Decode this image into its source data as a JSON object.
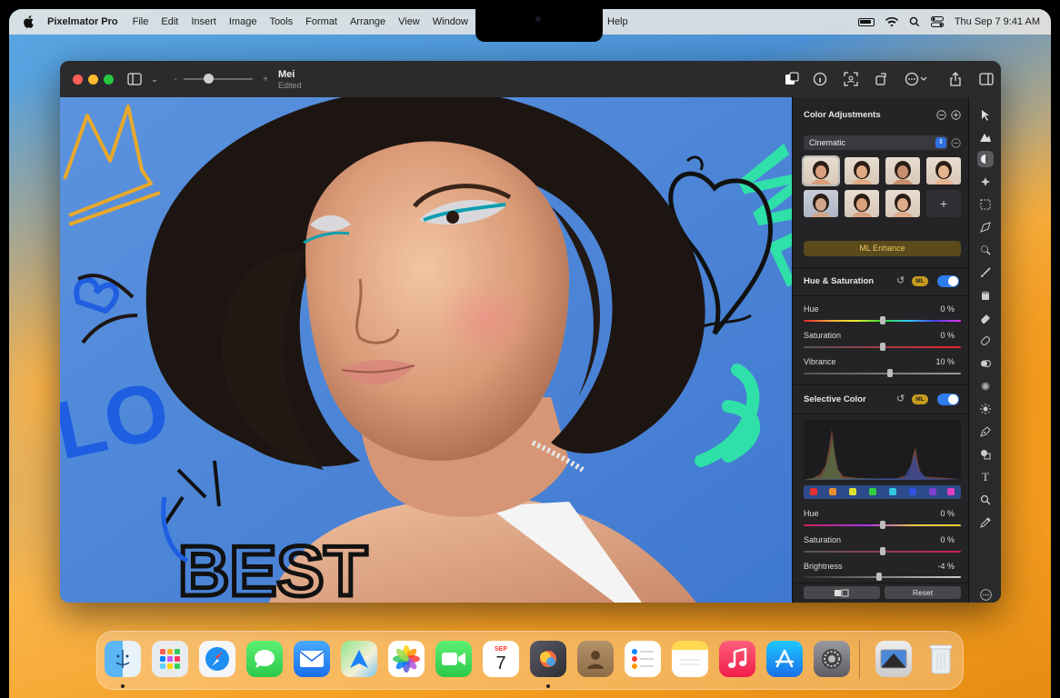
{
  "menubar": {
    "app_name": "Pixelmator Pro",
    "items": [
      "File",
      "Edit",
      "Insert",
      "Image",
      "Tools",
      "Format",
      "Arrange",
      "View",
      "Window"
    ],
    "help": "Help",
    "clock": "Thu Sep 7  9:41 AM"
  },
  "window": {
    "doc_title": "Mei",
    "doc_status": "Edited",
    "zoom_minus": "-",
    "zoom_plus": "+"
  },
  "canvas": {
    "graffiti_text": "BEST",
    "graffiti_text_2": "WE",
    "graffiti_text_3": "LO"
  },
  "sidebar": {
    "title": "Color Adjustments",
    "preset": "Cinematic",
    "ml_enhance": "ML Enhance",
    "add_thumb": "+",
    "hue_sat": {
      "title": "Hue & Saturation",
      "ml": "ML",
      "sliders": [
        {
          "label": "Hue",
          "value": "0 %",
          "level": 0.5
        },
        {
          "label": "Saturation",
          "value": "0 %",
          "level": 0.5
        },
        {
          "label": "Vibrance",
          "value": "10 %",
          "level": 0.55
        }
      ]
    },
    "selective": {
      "title": "Selective Color",
      "ml": "ML",
      "sliders": [
        {
          "label": "Hue",
          "value": "0 %",
          "level": 0.5
        },
        {
          "label": "Saturation",
          "value": "0 %",
          "level": 0.5
        },
        {
          "label": "Brightness",
          "value": "-4 %",
          "level": 0.48
        }
      ]
    },
    "reset": "Reset"
  },
  "dock": {
    "calendar_month": "SEP",
    "calendar_day": "7"
  }
}
